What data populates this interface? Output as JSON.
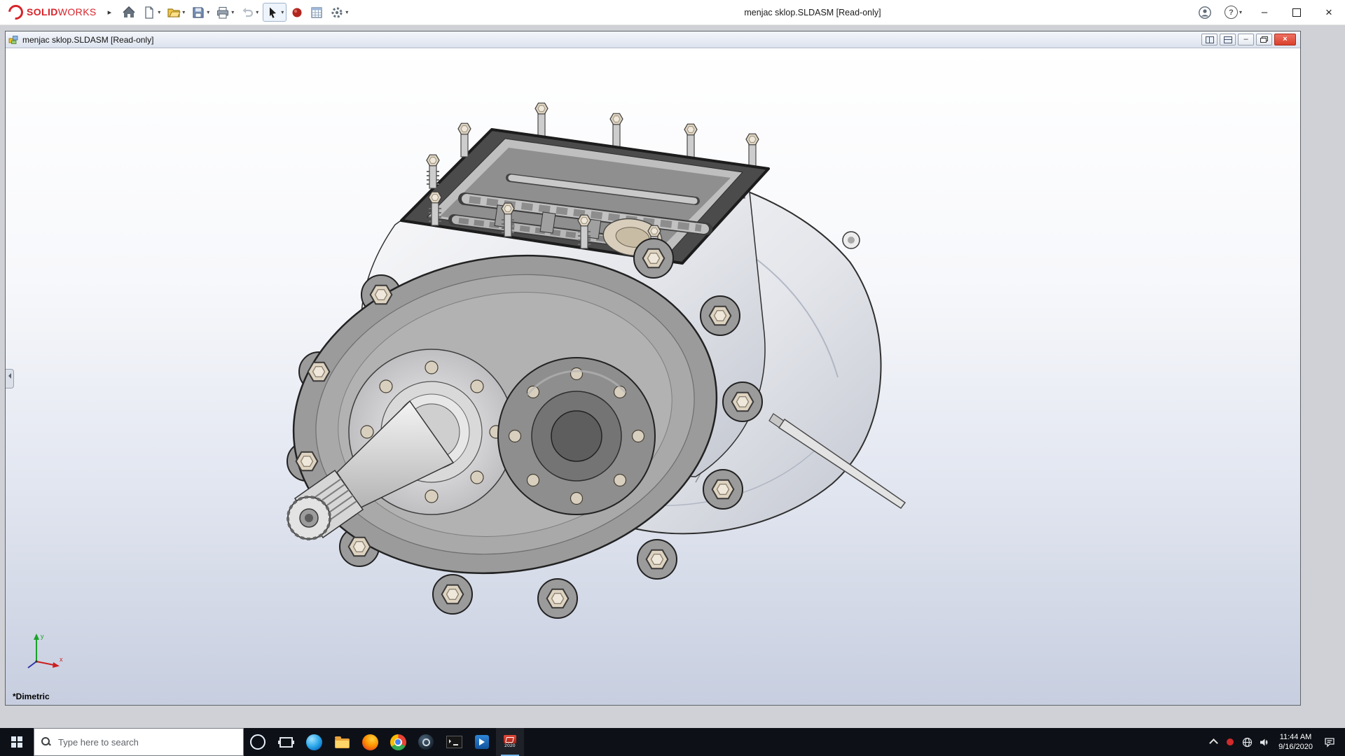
{
  "app": {
    "brand_bold": "SOLID",
    "brand_light": "WORKS",
    "title": "menjac sklop.SLDASM [Read-only]"
  },
  "icons": {
    "expand": "▸",
    "dropdown": "▾",
    "help": "?",
    "minimize": "–",
    "close": "×",
    "decorative_css_icons": [
      "3ds-logo-icon",
      "home-icon",
      "new-document-icon",
      "open-folder-icon",
      "save-icon",
      "print-icon",
      "undo-icon",
      "select-cursor-icon",
      "red-sphere-icon",
      "spreadsheet-icon",
      "options-gear-icon",
      "account-icon",
      "search-icon",
      "start-icon",
      "cortana-icon",
      "task-view-icon",
      "edge-icon",
      "file-explorer-icon",
      "firefox-icon",
      "chrome-icon",
      "steam-icon",
      "command-prompt-icon",
      "media-player-icon",
      "solidworks-taskbar-icon",
      "tray-chevron-icon",
      "tray-red-icon",
      "network-icon",
      "volume-icon",
      "action-center-icon",
      "assembly-doc-icon",
      "tile-vertical-icon",
      "tile-horizontal-icon",
      "restore-icon",
      "panel-collapse-icon"
    ]
  },
  "document": {
    "title": "menjac sklop.SLDASM [Read-only]",
    "view_orientation": "*Dimetric",
    "triad": {
      "x": "x",
      "y": "y"
    }
  },
  "taskbar": {
    "search_placeholder": "Type here to search",
    "time": "11:44 AM",
    "date": "9/16/2020",
    "solidworks_year": "2020"
  }
}
